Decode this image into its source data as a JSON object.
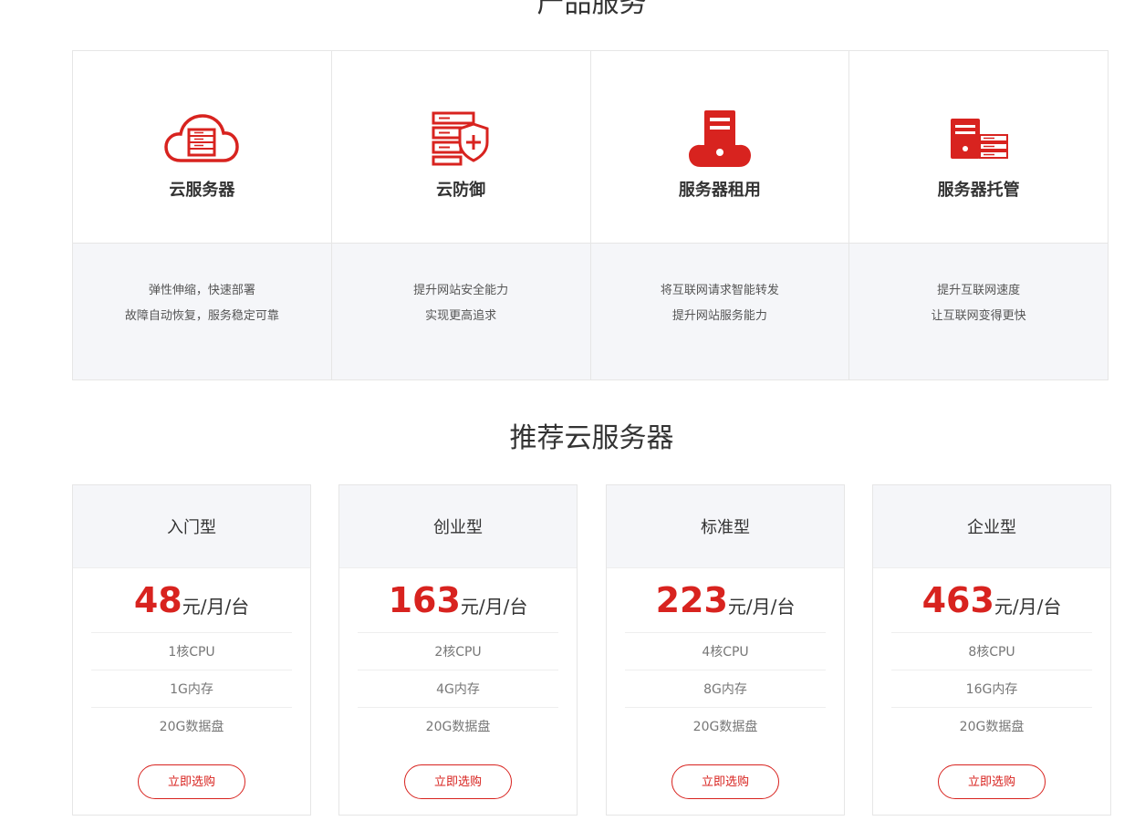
{
  "products_title": "产品服务",
  "accent_color": "#d8231f",
  "products": [
    {
      "icon": "cloud-server-icon",
      "name": "云服务器",
      "desc": [
        "弹性伸缩，快速部署",
        "故障自动恢复，服务稳定可靠"
      ]
    },
    {
      "icon": "shield-server-icon",
      "name": "云防御",
      "desc": [
        "提升网站安全能力",
        "实现更高追求"
      ]
    },
    {
      "icon": "server-tower-icon",
      "name": "服务器租用",
      "desc": [
        "将互联网请求智能转发",
        "提升网站服务能力"
      ]
    },
    {
      "icon": "server-rack-icon",
      "name": "服务器托管",
      "desc": [
        "提升互联网速度",
        "让互联网变得更快"
      ]
    }
  ],
  "recommend_title": "推荐云服务器",
  "plans": [
    {
      "name": "入门型",
      "price": "48",
      "unit": "元/月/台",
      "specs": [
        "1核CPU",
        "1G内存",
        "20G数据盘"
      ],
      "button": "立即选购"
    },
    {
      "name": "创业型",
      "price": "163",
      "unit": "元/月/台",
      "specs": [
        "2核CPU",
        "4G内存",
        "20G数据盘"
      ],
      "button": "立即选购"
    },
    {
      "name": "标准型",
      "price": "223",
      "unit": "元/月/台",
      "specs": [
        "4核CPU",
        "8G内存",
        "20G数据盘"
      ],
      "button": "立即选购"
    },
    {
      "name": "企业型",
      "price": "463",
      "unit": "元/月/台",
      "specs": [
        "8核CPU",
        "16G内存",
        "20G数据盘"
      ],
      "button": "立即选购"
    }
  ]
}
